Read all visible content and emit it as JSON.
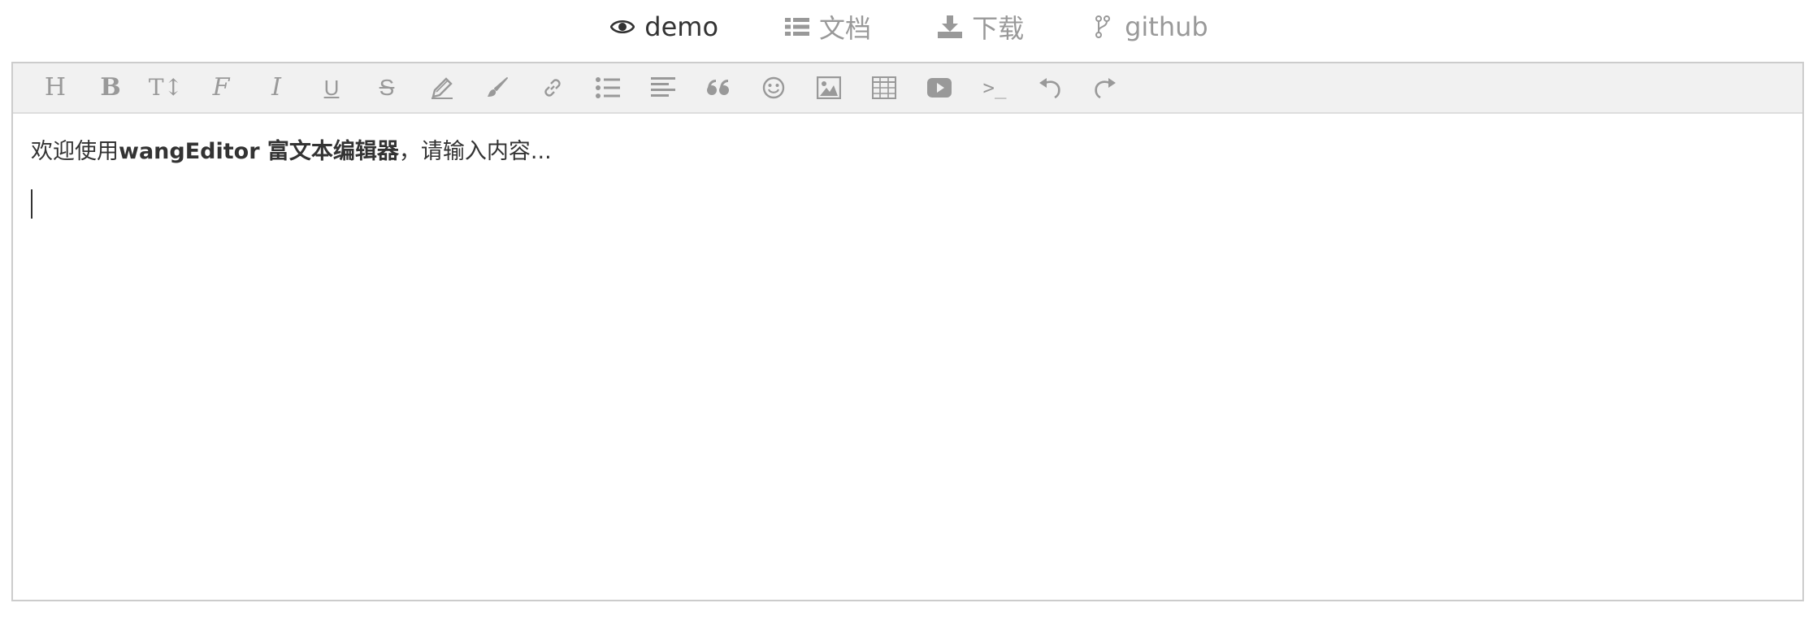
{
  "nav": {
    "items": [
      {
        "label": "demo",
        "icon": "eye-icon",
        "active": true
      },
      {
        "label": "文档",
        "icon": "list-icon",
        "active": false
      },
      {
        "label": "下载",
        "icon": "download-icon",
        "active": false
      },
      {
        "label": "github",
        "icon": "fork-icon",
        "active": false
      }
    ]
  },
  "toolbar": {
    "items": [
      {
        "icon": "heading-icon",
        "glyph": "H"
      },
      {
        "icon": "bold-icon",
        "glyph": "B"
      },
      {
        "icon": "font-size-icon",
        "glyph": "T↕"
      },
      {
        "icon": "font-family-icon",
        "glyph": "F"
      },
      {
        "icon": "italic-icon",
        "glyph": "I"
      },
      {
        "icon": "underline-icon",
        "glyph": "U"
      },
      {
        "icon": "strikethrough-icon",
        "glyph": "S"
      },
      {
        "icon": "pen-icon"
      },
      {
        "icon": "brush-icon"
      },
      {
        "icon": "link-icon"
      },
      {
        "icon": "bulleted-list-icon"
      },
      {
        "icon": "align-icon"
      },
      {
        "icon": "quote-icon",
        "glyph": "❝"
      },
      {
        "icon": "emoji-icon"
      },
      {
        "icon": "image-icon"
      },
      {
        "icon": "table-icon"
      },
      {
        "icon": "video-icon"
      },
      {
        "icon": "code-icon",
        "glyph": ">_"
      },
      {
        "icon": "undo-icon"
      },
      {
        "icon": "redo-icon"
      }
    ]
  },
  "content": {
    "line1_prefix": "欢迎使用",
    "line1_bold": "wangEditor 富文本编辑器",
    "line1_suffix": "，请输入内容..."
  },
  "colors": {
    "toolbar_bg": "#f1f1f1",
    "icon": "#999999",
    "text": "#333333",
    "border": "#cccccc"
  }
}
